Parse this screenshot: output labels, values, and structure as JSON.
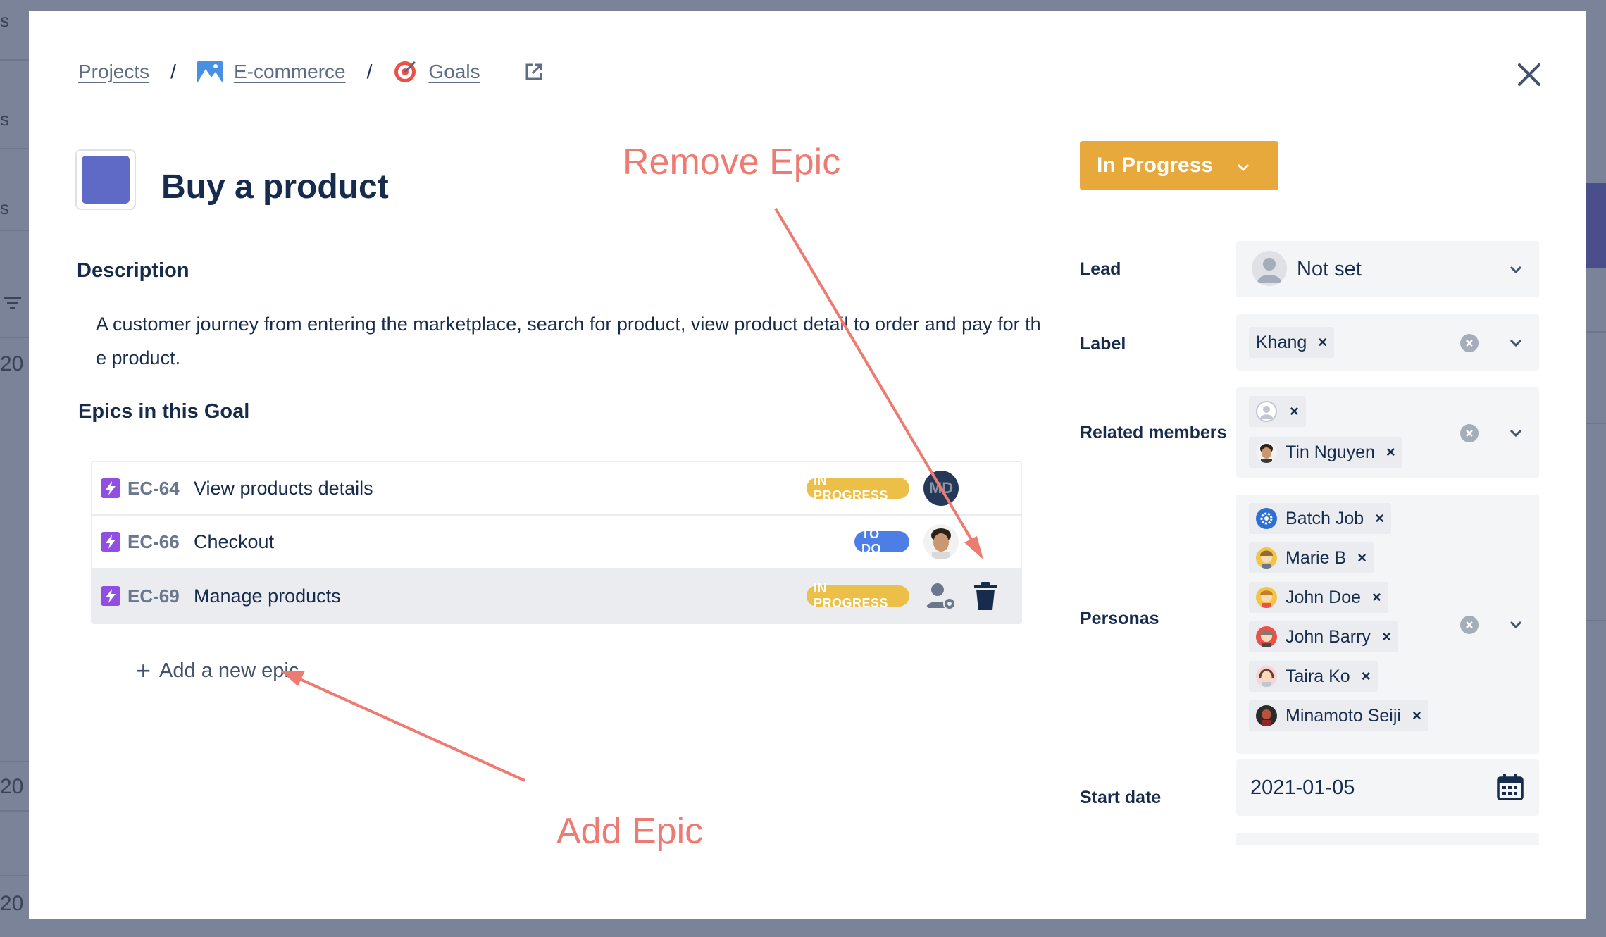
{
  "breadcrumb": {
    "projects": "Projects",
    "project": "E-commerce",
    "section": "Goals",
    "separator": "/"
  },
  "goal": {
    "title": "Buy a product",
    "color": "#5e6ac5",
    "description_heading": "Description",
    "description": "A customer journey from entering the marketplace, search for product, view product detail to order and pay for the product.",
    "epics_heading": "Epics in this Goal"
  },
  "epics": [
    {
      "key": "EC-64",
      "name": "View products details",
      "status": "IN PROGRESS",
      "avatar_initials": "MD"
    },
    {
      "key": "EC-66",
      "name": "Checkout",
      "status": "TO DO"
    },
    {
      "key": "EC-69",
      "name": "Manage products",
      "status": "IN PROGRESS"
    }
  ],
  "add_epic_label": "Add a new epic",
  "annotations": {
    "remove": "Remove Epic",
    "add": "Add Epic"
  },
  "status_button": {
    "label": "In Progress",
    "color": "#e8a93c"
  },
  "fields": {
    "lead_label": "Lead",
    "lead_value": "Not set",
    "label_label": "Label",
    "label_chips": [
      "Khang"
    ],
    "related_label": "Related members",
    "related_members": [
      "",
      "Tin Nguyen"
    ],
    "personas_label": "Personas",
    "personas": [
      "Batch Job",
      "Marie B",
      "John Doe",
      "John Barry",
      "Taira Ko",
      "Minamoto Seiji"
    ],
    "start_date_label": "Start date",
    "start_date": "2021-01-05"
  },
  "background": {
    "glyphs": [
      "s",
      "s",
      "s",
      "20",
      "20",
      "20"
    ]
  },
  "icons": {
    "close": "close-icon",
    "external": "external-link-icon",
    "trash": "trash-icon",
    "calendar": "calendar-icon"
  }
}
